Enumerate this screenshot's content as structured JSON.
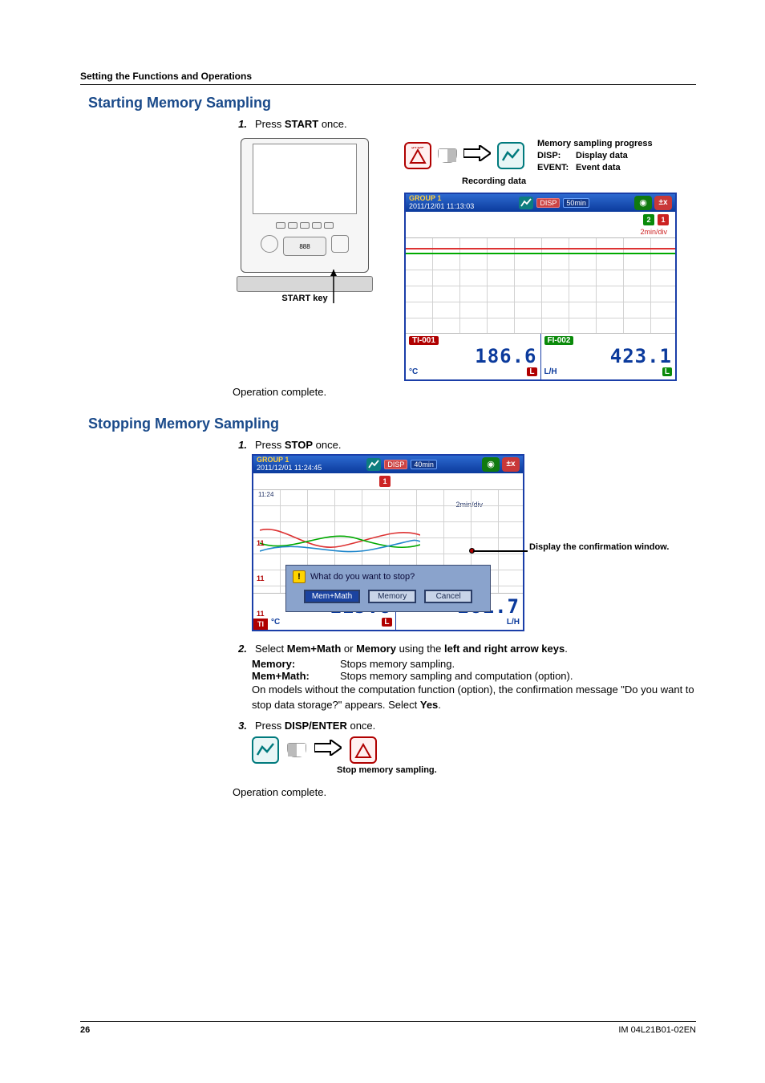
{
  "section_header": "Setting the Functions and Operations",
  "starting": {
    "title": "Starting Memory Sampling",
    "step1_num": "1.",
    "step1_a": "Press ",
    "step1_key": "START",
    "step1_b": " once.",
    "start_key_label": "START key",
    "op_complete": "Operation complete.",
    "icon_row": {
      "recording_caption": "Recording data",
      "legend_line1": "Memory sampling progress",
      "legend_line2a": "DISP:",
      "legend_line2b": "Display data",
      "legend_line3a": "EVENT:",
      "legend_line3b": "Event data"
    },
    "screen": {
      "group": "GROUP 1",
      "timestamp": "2011/12/01 11:13:03",
      "mode_chip": "DISP",
      "time_chip": "50min",
      "alarms": [
        "2",
        "1"
      ],
      "time_div": "2min/div",
      "ch1_tag": "TI-001",
      "ch1_val": "186.6",
      "ch1_unit": "°C",
      "ch1_alert": "L",
      "ch2_tag": "FI-002",
      "ch2_val": "423.1",
      "ch2_unit": "L/H",
      "ch2_alert": "L"
    }
  },
  "stopping": {
    "title": "Stopping Memory Sampling",
    "step1_num": "1.",
    "step1_a": "Press ",
    "step1_key": "STOP",
    "step1_b": " once.",
    "confirm_callout": "Display the confirmation window.",
    "screen": {
      "group": "GROUP 1",
      "timestamp": "2011/12/01 11:24:45",
      "mode_chip": "DISP",
      "time_chip": "40min",
      "side_time": "11:24",
      "time_div": "2min/div",
      "side_tags": [
        "11",
        "11",
        "11"
      ],
      "dialog_question": "What do you want to stop?",
      "btn_memmath": "Mem+Math",
      "btn_memory": "Memory",
      "btn_cancel": "Cancel",
      "bottom_tag": "TI",
      "ch1_val": "115.8",
      "ch1_unit": "°C",
      "ch1_alert": "L",
      "ch2_val": "281.7",
      "ch2_unit": "L/H",
      "alarm": "1"
    },
    "step2_num": "2.",
    "step2_a": "Select ",
    "step2_b": "Mem+Math",
    "step2_c": " or ",
    "step2_d": "Memory",
    "step2_e": " using the ",
    "step2_f": "left and right arrow keys",
    "step2_g": ".",
    "def_memory_term": "Memory",
    "def_memory_colon": ":",
    "def_memory_text": "Stops memory sampling.",
    "def_memmath_term": "Mem+Math",
    "def_memmath_colon": ":",
    "def_memmath_text": "Stops memory sampling and computation (option).",
    "note_a": "On models without the computation function (option), the confirmation message \"Do you want to stop data storage?\" appears. Select ",
    "note_b": "Yes",
    "note_c": ".",
    "step3_num": "3.",
    "step3_a": "Press ",
    "step3_key": "DISP/ENTER",
    "step3_b": " once.",
    "flow_caption": "Stop memory sampling.",
    "op_complete": "Operation complete."
  },
  "footer": {
    "page": "26",
    "doc": "IM 04L21B01-02EN"
  }
}
